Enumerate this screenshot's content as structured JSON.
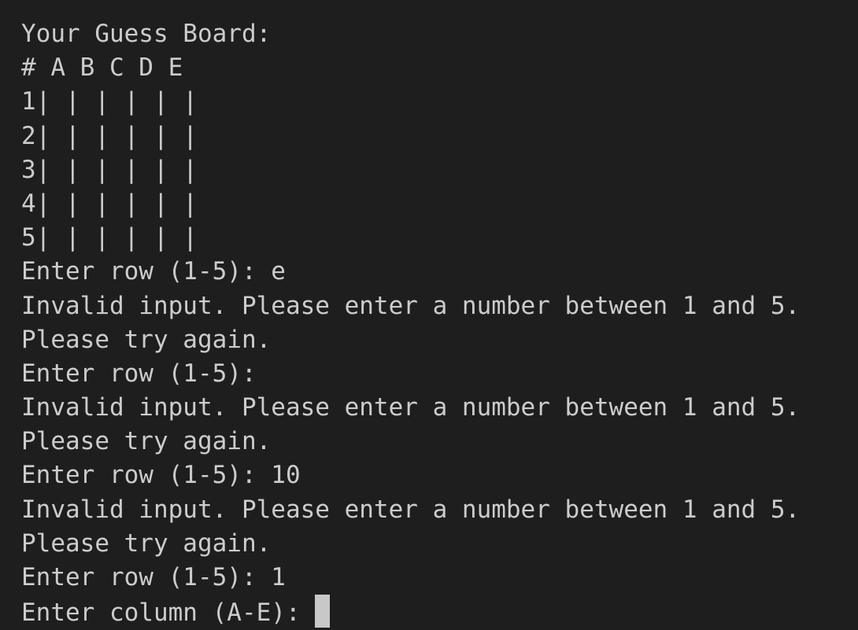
{
  "terminal": {
    "board_title": "Your Guess Board:",
    "header_row": "# A B C D E",
    "board_rows": [
      "1| | | | | |",
      "2| | | | | |",
      "3| | | | | |",
      "4| | | | | |",
      "5| | | | | |"
    ],
    "lines": [
      "Enter row (1-5): e",
      "Invalid input. Please enter a number between 1 and 5.",
      "Please try again.",
      "Enter row (1-5):",
      "Invalid input. Please enter a number between 1 and 5.",
      "Please try again.",
      "Enter row (1-5): 10",
      "Invalid input. Please enter a number between 1 and 5.",
      "Please try again.",
      "Enter row (1-5): 1"
    ],
    "current_prompt": "Enter column (A-E): ",
    "current_input": "",
    "colors": {
      "background": "#1e1e1e",
      "text": "#cccccc",
      "cursor": "#c8c8c8"
    }
  }
}
